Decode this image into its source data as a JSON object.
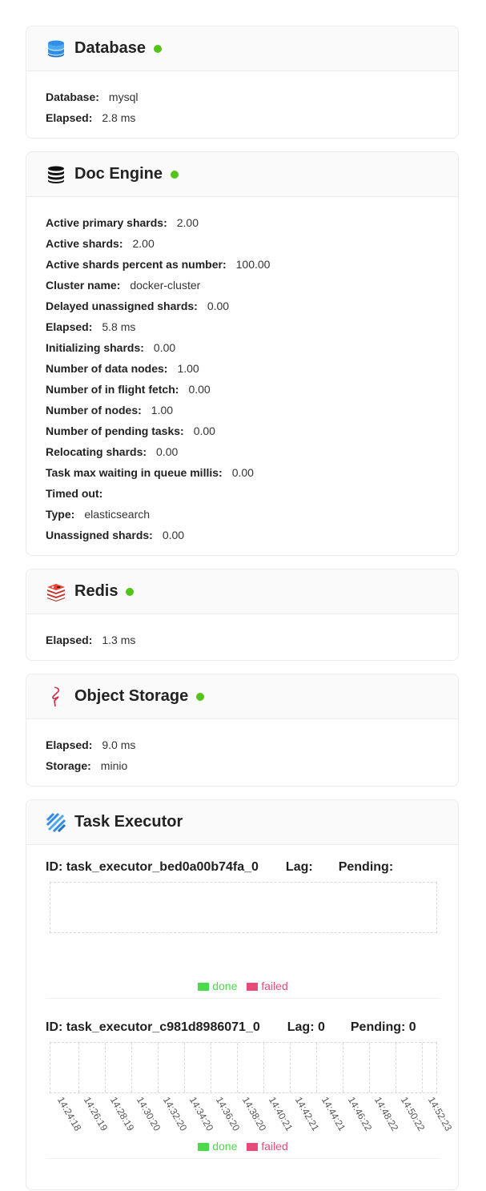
{
  "database": {
    "title": "Database",
    "icon": "database-icon",
    "status_color": "#52c41a",
    "rows": [
      {
        "key": "Database:",
        "value": "mysql"
      },
      {
        "key": "Elapsed:",
        "value": "2.8 ms"
      }
    ]
  },
  "doc_engine": {
    "title": "Doc Engine",
    "icon": "stacked-disks-icon",
    "status_color": "#52c41a",
    "rows": [
      {
        "key": "Active primary shards:",
        "value": "2.00"
      },
      {
        "key": "Active shards:",
        "value": "2.00"
      },
      {
        "key": "Active shards percent as number:",
        "value": "100.00"
      },
      {
        "key": "Cluster name:",
        "value": "docker-cluster"
      },
      {
        "key": "Delayed unassigned shards:",
        "value": "0.00"
      },
      {
        "key": "Elapsed:",
        "value": "5.8 ms"
      },
      {
        "key": "Initializing shards:",
        "value": "0.00"
      },
      {
        "key": "Number of data nodes:",
        "value": "1.00"
      },
      {
        "key": "Number of in flight fetch:",
        "value": "0.00"
      },
      {
        "key": "Number of nodes:",
        "value": "1.00"
      },
      {
        "key": "Number of pending tasks:",
        "value": "0.00"
      },
      {
        "key": "Relocating shards:",
        "value": "0.00"
      },
      {
        "key": "Task max waiting in queue millis:",
        "value": "0.00"
      },
      {
        "key": "Timed out:",
        "value": ""
      },
      {
        "key": "Type:",
        "value": "elasticsearch"
      },
      {
        "key": "Unassigned shards:",
        "value": "0.00"
      }
    ]
  },
  "redis": {
    "title": "Redis",
    "icon": "redis-icon",
    "status_color": "#52c41a",
    "rows": [
      {
        "key": "Elapsed:",
        "value": "1.3 ms"
      }
    ]
  },
  "object_storage": {
    "title": "Object Storage",
    "icon": "minio-bird-icon",
    "status_color": "#52c41a",
    "rows": [
      {
        "key": "Elapsed:",
        "value": "9.0 ms"
      },
      {
        "key": "Storage:",
        "value": "minio"
      }
    ]
  },
  "task_executor": {
    "title": "Task Executor",
    "icon": "task-executor-icon",
    "legend": {
      "done": "done",
      "failed": "failed",
      "done_color": "#4cd94c",
      "failed_color": "#e84a7a"
    },
    "executors": [
      {
        "id": "ID: task_executor_bed0a00b74fa_0",
        "lag": "Lag:",
        "pending": "Pending:",
        "ticks": []
      },
      {
        "id": "ID: task_executor_c981d8986071_0",
        "lag": "Lag: 0",
        "pending": "Pending: 0",
        "ticks": [
          "14:24:18",
          "14:26:19",
          "14:28:19",
          "14:30:20",
          "14:32:20",
          "14:34:20",
          "14:36:20",
          "14:38:20",
          "14:40:21",
          "14:42:21",
          "14:44:21",
          "14:46:22",
          "14:48:22",
          "14:50:22",
          "14:52:23"
        ]
      }
    ]
  }
}
